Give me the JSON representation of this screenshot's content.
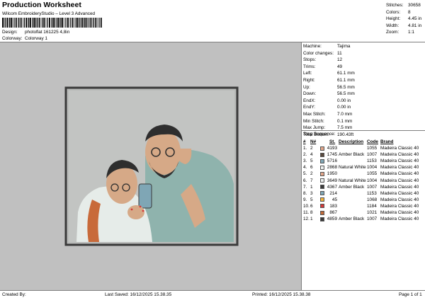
{
  "header": {
    "title": "Production Worksheet",
    "subtitle": "Wilcom EmbroideryStudio – Level 3 Advanced",
    "design_label": "Design:",
    "design_value": "photoflat 161225 4,8in",
    "colorway_label": "Colorway:",
    "colorway_value": "Colorway 1"
  },
  "stats": [
    {
      "label": "Stitches:",
      "value": "30658"
    },
    {
      "label": "Colors:",
      "value": "8"
    },
    {
      "label": "Height:",
      "value": "4.45 in"
    },
    {
      "label": "Width:",
      "value": "4.81 in"
    },
    {
      "label": "Zoom:",
      "value": "1:1"
    }
  ],
  "info": [
    {
      "label": "Machine:",
      "value": "Tajima"
    },
    {
      "label": "Color changes:",
      "value": "11"
    },
    {
      "label": "Stops:",
      "value": "12"
    },
    {
      "label": "Trims:",
      "value": "49"
    },
    {
      "label": "Left:",
      "value": "61.1 mm"
    },
    {
      "label": "Right:",
      "value": "61.1 mm"
    },
    {
      "label": "Up:",
      "value": "56.5 mm"
    },
    {
      "label": "Down:",
      "value": "56.5 mm"
    },
    {
      "label": "EndX:",
      "value": "0.00 in"
    },
    {
      "label": "EndY:",
      "value": "0.00 in"
    },
    {
      "label": "Max Stitch:",
      "value": "7.0 mm"
    },
    {
      "label": "Min Stitch:",
      "value": "0.1 mm"
    },
    {
      "label": "Max Jump:",
      "value": "7.5 mm"
    },
    {
      "label": "Total Bobbin:",
      "value": "190.43ft"
    }
  ],
  "sequence": {
    "title": "Stop Sequence:",
    "headers": {
      "num": "#",
      "n": "N#",
      "st": "St.",
      "desc": "Description",
      "code": "Code",
      "brand": "Brand"
    },
    "rows": [
      {
        "num": "1.",
        "n": "2",
        "color": "#e0a58a",
        "st": "4193",
        "desc": "",
        "code": "1055",
        "brand": "Madeira Classic 40"
      },
      {
        "num": "2.",
        "n": "4",
        "color": "#5a4a3e",
        "st": "1745",
        "desc": "Amber Black",
        "code": "1007",
        "brand": "Madeira Classic 40"
      },
      {
        "num": "3.",
        "n": "5",
        "color": "#7fa6b5",
        "st": "5716",
        "desc": "",
        "code": "1153",
        "brand": "Madeira Classic 40"
      },
      {
        "num": "4.",
        "n": "6",
        "color": "#ecefee",
        "st": "2868",
        "desc": "Natural White",
        "code": "1004",
        "brand": "Madeira Classic 40"
      },
      {
        "num": "5.",
        "n": "2",
        "color": "#e0a58a",
        "st": "1950",
        "desc": "",
        "code": "1055",
        "brand": "Madeira Classic 40"
      },
      {
        "num": "6.",
        "n": "7",
        "color": "#ecefee",
        "st": "3649",
        "desc": "Natural White",
        "code": "1004",
        "brand": "Madeira Classic 40"
      },
      {
        "num": "7.",
        "n": "1",
        "color": "#3b3b3b",
        "st": "4367",
        "desc": "Amber Black",
        "code": "1007",
        "brand": "Madeira Classic 40"
      },
      {
        "num": "8.",
        "n": "3",
        "color": "#7fa6b5",
        "st": "214",
        "desc": "",
        "code": "1153",
        "brand": "Madeira Classic 40"
      },
      {
        "num": "9.",
        "n": "5",
        "color": "#f0b23a",
        "st": "45",
        "desc": "",
        "code": "1068",
        "brand": "Madeira Classic 40"
      },
      {
        "num": "10.",
        "n": "6",
        "color": "#d33a3a",
        "st": "183",
        "desc": "",
        "code": "1184",
        "brand": "Madeira Classic 40"
      },
      {
        "num": "11.",
        "n": "8",
        "color": "#c06a3a",
        "st": "867",
        "desc": "",
        "code": "1021",
        "brand": "Madeira Classic 40"
      },
      {
        "num": "12.",
        "n": "1",
        "color": "#3b3b3b",
        "st": "4859",
        "desc": "Amber Black",
        "code": "1007",
        "brand": "Madeira Classic 40"
      }
    ]
  },
  "footer": {
    "created": "Created By:",
    "saved": "Last Saved: 16/12/2025 15.38.35",
    "printed": "Printed: 16/12/2025 15.38.38",
    "page": "Page 1 of 1"
  },
  "colors": {
    "canvas_bg": "#c0c0c0",
    "frame": "#3a3a3a",
    "shirt_teal": "#8fb3ad",
    "shirt_white": "#e6ece9",
    "skin": "#d6a987",
    "hair": "#2e2e2e",
    "bag": "#c86a3a"
  }
}
